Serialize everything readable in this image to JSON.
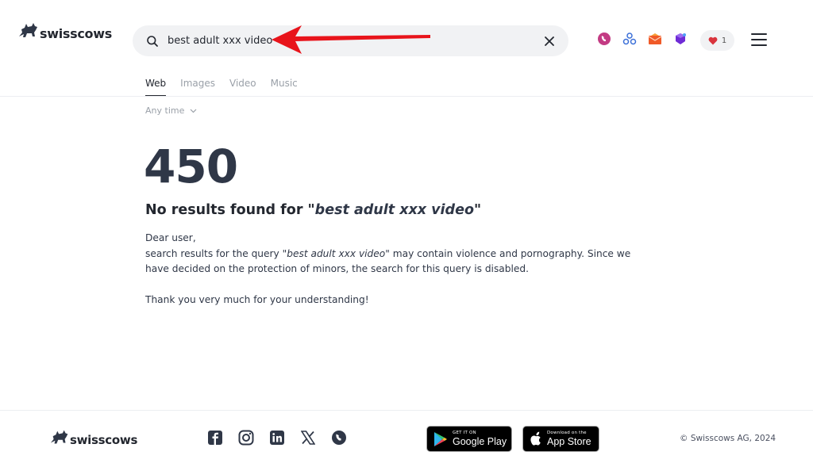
{
  "header": {
    "logo_text": "swisscows",
    "search": {
      "value": "best adult xxx video",
      "placeholder": ""
    },
    "icons": [
      "teleguard-icon",
      "vpn-icon",
      "mail-icon",
      "cube-icon"
    ],
    "heart_count": "1"
  },
  "tabs": [
    {
      "label": "Web",
      "active": true
    },
    {
      "label": "Images",
      "active": false
    },
    {
      "label": "Video",
      "active": false
    },
    {
      "label": "Music",
      "active": false
    }
  ],
  "filter": {
    "label": "Any time"
  },
  "main": {
    "code": "450",
    "title_prefix": "No results found for \"",
    "title_query": "best adult xxx video",
    "title_suffix": "\"",
    "greeting": "Dear user,",
    "msg_prefix": "search results for the query \"",
    "msg_query": "best adult xxx video",
    "msg_suffix": "\" may contain violence and pornography. Since we have decided on the protection of minors, the search for this query is disabled.",
    "thanks": "Thank you very much for your understanding!"
  },
  "footer": {
    "logo_text": "swisscows",
    "socials": [
      "facebook-icon",
      "instagram-icon",
      "linkedin-icon",
      "x-icon",
      "teleguard-icon"
    ],
    "google_play": {
      "small": "GET IT ON",
      "big": "Google Play"
    },
    "app_store": {
      "small": "Download on the",
      "big": "App Store"
    },
    "copyright": "© Swisscows AG, 2024"
  },
  "colors": {
    "text": "#23272f",
    "muted": "#9aa0a8",
    "search_bg": "#f1f2f4",
    "arrow": "#e8141b",
    "heart": "#d9343d"
  }
}
